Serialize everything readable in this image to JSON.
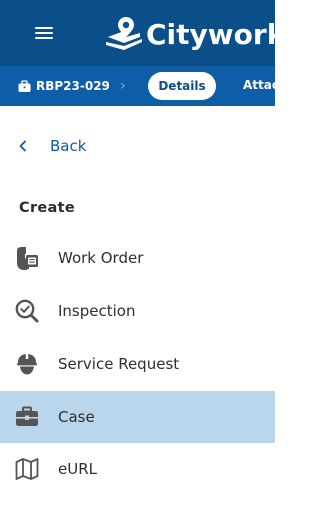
{
  "header": {
    "app_name": "Cityworks",
    "menu_icon": "hamburger-menu-icon"
  },
  "subbar": {
    "record_id": "RBP23-029",
    "record_icon": "briefcase-icon",
    "active_tab": "Details",
    "next_tab": "Attac"
  },
  "nav": {
    "back_label": "Back"
  },
  "create": {
    "title": "Create",
    "items": [
      {
        "label": "Work Order",
        "icon": "work-order-icon"
      },
      {
        "label": "Inspection",
        "icon": "inspection-icon"
      },
      {
        "label": "Service Request",
        "icon": "service-request-icon"
      },
      {
        "label": "Case",
        "icon": "case-icon",
        "selected": true
      },
      {
        "label": "eURL",
        "icon": "map-icon"
      }
    ]
  },
  "colors": {
    "header_bg": "#0b4f8a",
    "subbar_bg": "#0e5da7",
    "selected_bg": "#b9d6ec",
    "link": "#0e5da7"
  }
}
